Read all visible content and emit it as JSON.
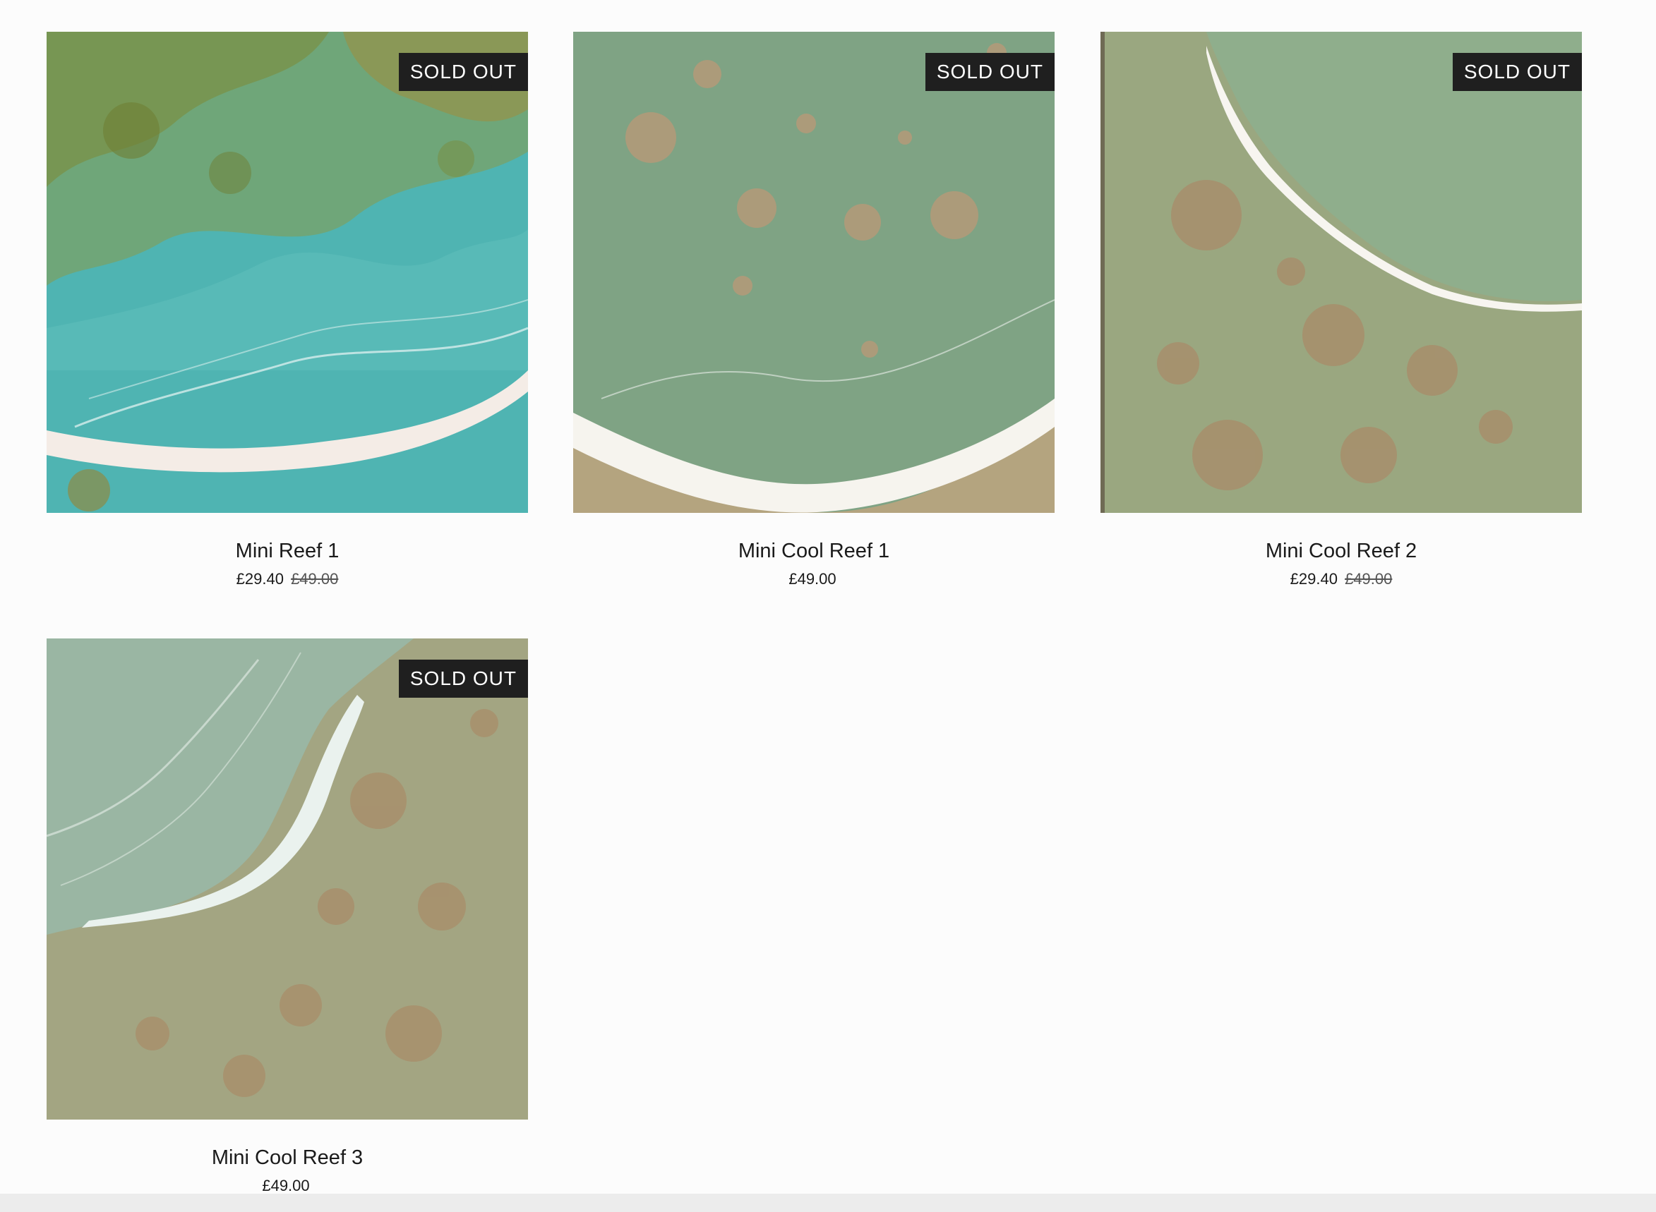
{
  "products": [
    {
      "name": "Mini Reef 1",
      "badge": "SOLD OUT",
      "price": "£29.40",
      "compare_price": "£49.00",
      "palette": {
        "water": "#5fb7b4",
        "deep": "#3ea6a6",
        "sand": "#7c8a3d",
        "foam": "#f4ece6"
      }
    },
    {
      "name": "Mini Cool Reef 1",
      "badge": "SOLD OUT",
      "price": "£49.00",
      "compare_price": "",
      "palette": {
        "water": "#86a88a",
        "deep": "#7b9d7f",
        "sand": "#b6a47e",
        "foam": "#f6f4ee"
      }
    },
    {
      "name": "Mini Cool Reef 2",
      "badge": "SOLD OUT",
      "price": "£29.40",
      "compare_price": "£49.00",
      "palette": {
        "water": "#8fa885",
        "deep": "#9aa37f",
        "sand": "#a98f6d",
        "foam": "#f7f5f0"
      }
    },
    {
      "name": "Mini Cool Reef 3",
      "badge": "SOLD OUT",
      "price": "£49.00",
      "compare_price": "",
      "palette": {
        "water": "#9bb7a5",
        "deep": "#a3a983",
        "sand": "#a58d6b",
        "foam": "#eef3ef"
      }
    }
  ]
}
